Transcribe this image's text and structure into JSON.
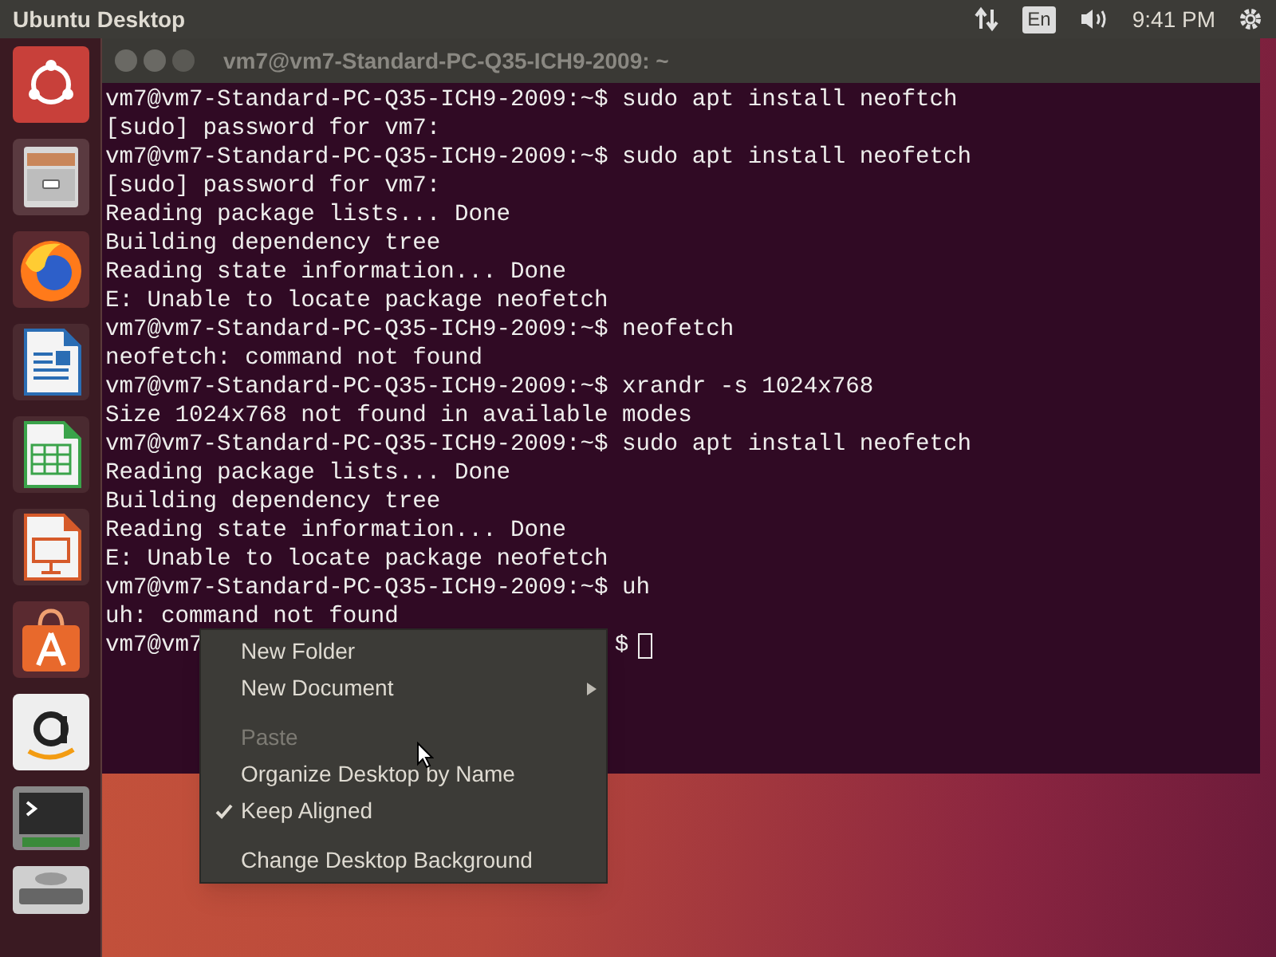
{
  "top_bar": {
    "title": "Ubuntu Desktop",
    "keyboard": "En",
    "clock": "9:41 PM"
  },
  "launcher": {
    "items": [
      {
        "kind": "ubuntu"
      },
      {
        "kind": "files"
      },
      {
        "kind": "firefox"
      },
      {
        "kind": "writer"
      },
      {
        "kind": "calc"
      },
      {
        "kind": "impress"
      },
      {
        "kind": "software"
      },
      {
        "kind": "amazon"
      },
      {
        "kind": "terminal"
      },
      {
        "kind": "dvd"
      }
    ]
  },
  "terminal": {
    "title": "vm7@vm7-Standard-PC-Q35-ICH9-2009: ~",
    "lines": [
      "vm7@vm7-Standard-PC-Q35-ICH9-2009:~$ sudo apt install neoftch",
      "[sudo] password for vm7:",
      "vm7@vm7-Standard-PC-Q35-ICH9-2009:~$ sudo apt install neofetch",
      "[sudo] password for vm7:",
      "Reading package lists... Done",
      "Building dependency tree",
      "Reading state information... Done",
      "E: Unable to locate package neofetch",
      "vm7@vm7-Standard-PC-Q35-ICH9-2009:~$ neofetch",
      "neofetch: command not found",
      "vm7@vm7-Standard-PC-Q35-ICH9-2009:~$ xrandr -s 1024x768",
      "Size 1024x768 not found in available modes",
      "vm7@vm7-Standard-PC-Q35-ICH9-2009:~$ sudo apt install neofetch",
      "Reading package lists... Done",
      "Building dependency tree",
      "Reading state information... Done",
      "E: Unable to locate package neofetch",
      "vm7@vm7-Standard-PC-Q35-ICH9-2009:~$ uh",
      "uh: command not found"
    ],
    "last_line": {
      "left": "vm7@vm7",
      "right": "$"
    }
  },
  "context_menu": {
    "groups": [
      [
        {
          "label": "New Folder",
          "disabled": false,
          "checked": false,
          "submenu": false
        },
        {
          "label": "New Document",
          "disabled": false,
          "checked": false,
          "submenu": true
        }
      ],
      [
        {
          "label": "Paste",
          "disabled": true,
          "checked": false,
          "submenu": false
        },
        {
          "label": "Organize Desktop by Name",
          "disabled": false,
          "checked": false,
          "submenu": false
        },
        {
          "label": "Keep Aligned",
          "disabled": false,
          "checked": true,
          "submenu": false
        }
      ],
      [
        {
          "label": "Change Desktop Background",
          "disabled": false,
          "checked": false,
          "submenu": false
        }
      ]
    ]
  }
}
